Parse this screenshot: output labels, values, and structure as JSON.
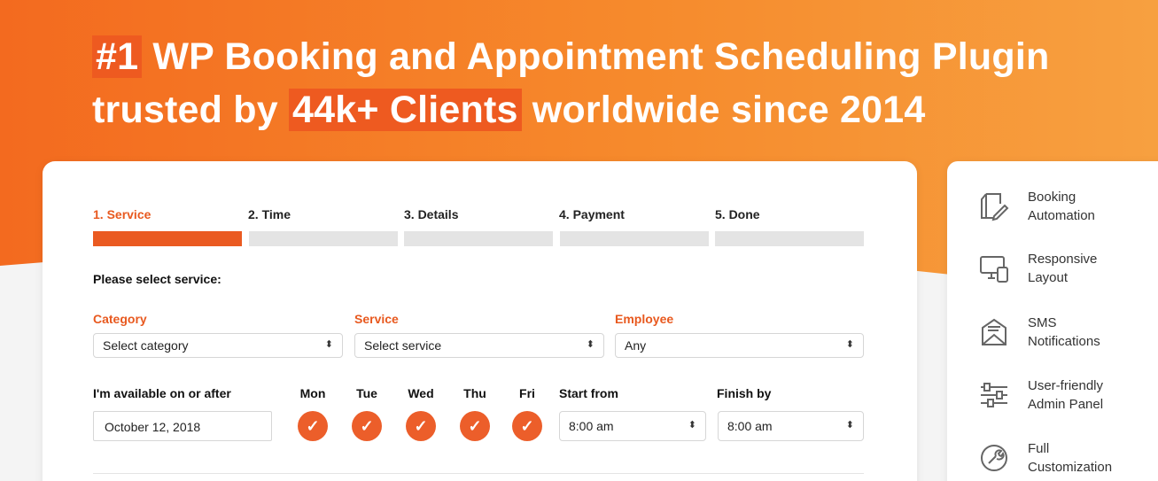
{
  "headline": {
    "line1_badge": "#1",
    "line1_rest": "WP Booking and Appointment Scheduling Plugin",
    "line2_pre": "trusted by",
    "line2_badge": "44k+ Clients",
    "line2_post": "worldwide since 2014"
  },
  "steps": [
    {
      "label": "1. Service",
      "active": true
    },
    {
      "label": "2. Time",
      "active": false
    },
    {
      "label": "3. Details",
      "active": false
    },
    {
      "label": "4. Payment",
      "active": false
    },
    {
      "label": "5. Done",
      "active": false
    }
  ],
  "form": {
    "subhead": "Please select service:",
    "category": {
      "label": "Category",
      "value": "Select category"
    },
    "service": {
      "label": "Service",
      "value": "Select service"
    },
    "employee": {
      "label": "Employee",
      "value": "Any"
    },
    "available_label": "I'm available on or after",
    "date_value": "October 12, 2018",
    "days": [
      {
        "label": "Mon",
        "checked": true
      },
      {
        "label": "Tue",
        "checked": true
      },
      {
        "label": "Wed",
        "checked": true
      },
      {
        "label": "Thu",
        "checked": true
      },
      {
        "label": "Fri",
        "checked": true
      }
    ],
    "start": {
      "label": "Start from",
      "value": "8:00 am"
    },
    "finish": {
      "label": "Finish by",
      "value": "8:00 am"
    },
    "select_arrow": "⬍",
    "check_glyph": "✓"
  },
  "features": [
    {
      "line1": "Booking",
      "line2": "Automation",
      "icon": "booking-automation-icon"
    },
    {
      "line1": "Responsive",
      "line2": "Layout",
      "icon": "responsive-layout-icon"
    },
    {
      "line1": "SMS",
      "line2": "Notifications",
      "icon": "sms-notifications-icon"
    },
    {
      "line1": "User-friendly",
      "line2": "Admin Panel",
      "icon": "admin-panel-icon"
    },
    {
      "line1": "Full",
      "line2": "Customization",
      "icon": "customization-icon"
    }
  ],
  "colors": {
    "accent": "#ea5a21",
    "hero_start": "#f36a1f",
    "hero_end": "#f7a040",
    "icon": "#666666"
  }
}
